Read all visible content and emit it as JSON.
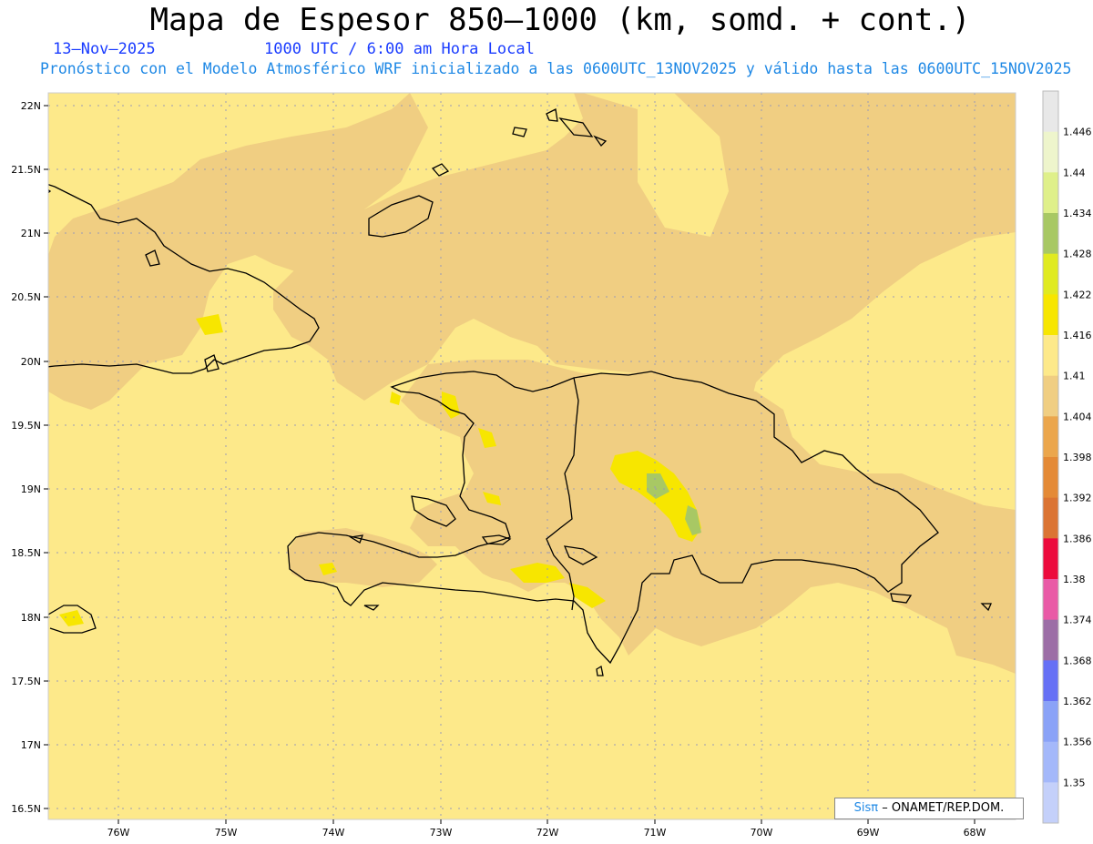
{
  "header": {
    "title": "Mapa de Espesor 850–1000 (km, somd. + cont.)",
    "date": "13–Nov–2025",
    "time": "1000 UTC / 6:00 am Hora Local",
    "description": "Pronóstico con el Modelo Atmosférico WRF inicializado a las 0600UTC_13NOV2025 y válido hasta las  0600UTC_15NOV2025"
  },
  "map": {
    "lat_labels": [
      "22N",
      "21.5N",
      "21N",
      "20.5N",
      "20N",
      "19.5N",
      "19N",
      "18.5N",
      "18N",
      "17.5N",
      "17N",
      "16.5N"
    ],
    "lon_labels": [
      "76W",
      "75W",
      "74W",
      "73W",
      "72W",
      "71W",
      "70W",
      "69W",
      "68W"
    ],
    "colors": {
      "thickness_1404_1410": "#f0ce82",
      "thickness_1410_1416": "#fde98a",
      "thickness_1416_1422": "#f7e600",
      "thickness_1428_1434": "#a8c864",
      "coastline": "#000000"
    }
  },
  "colorbar": {
    "labels": [
      "1.446",
      "1.44",
      "1.434",
      "1.428",
      "1.422",
      "1.416",
      "1.41",
      "1.404",
      "1.398",
      "1.392",
      "1.386",
      "1.38",
      "1.374",
      "1.368",
      "1.362",
      "1.356",
      "1.35"
    ],
    "colors": [
      "#e8e8e8",
      "#eef5cc",
      "#dff08a",
      "#a8c864",
      "#e0ea20",
      "#f7e600",
      "#fde98a",
      "#f0ce82",
      "#eba64c",
      "#e48a36",
      "#db7433",
      "#ec0a3c",
      "#e95aa6",
      "#9c6ea6",
      "#6670f5",
      "#8aa2f7",
      "#a4b8fa",
      "#c4d0fa"
    ]
  },
  "credit": {
    "brand": "Sisπ",
    "rest": "– ONAMET/REP.DOM."
  }
}
